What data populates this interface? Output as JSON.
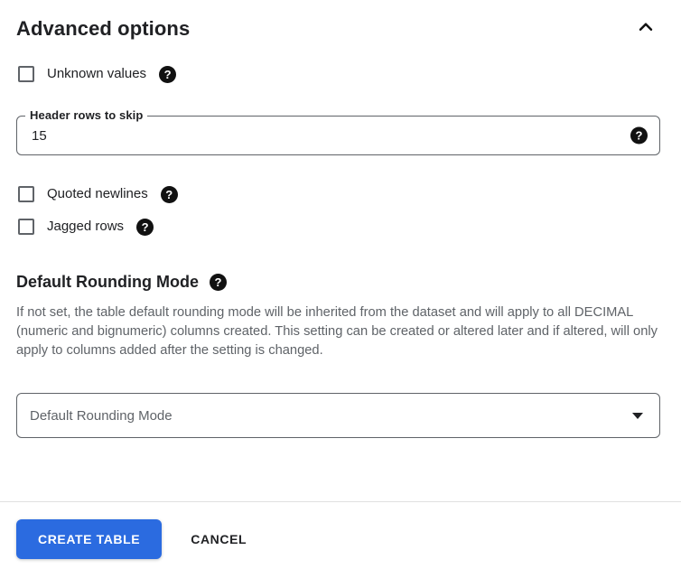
{
  "header": {
    "title": "Advanced options"
  },
  "fields": {
    "unknown_values": {
      "label": "Unknown values",
      "checked": false
    },
    "header_rows_to_skip": {
      "label": "Header rows to skip",
      "value": "15"
    },
    "quoted_newlines": {
      "label": "Quoted newlines",
      "checked": false
    },
    "jagged_rows": {
      "label": "Jagged rows",
      "checked": false
    },
    "default_rounding_mode": {
      "title": "Default Rounding Mode",
      "description": "If not set, the table default rounding mode will be inherited from the dataset and will apply to all DECIMAL (numeric and bignumeric) columns created. This setting can be created or altered later and if altered, will only apply to columns added after the setting is changed.",
      "placeholder": "Default Rounding Mode"
    }
  },
  "footer": {
    "create_button": "CREATE TABLE",
    "cancel_button": "CANCEL"
  },
  "icons": {
    "help_glyph": "?",
    "collapse": "chevron-up",
    "select_caret": "arrow-drop-down"
  },
  "colors": {
    "primary_button": "#2b6be0",
    "text_primary": "#202124",
    "text_secondary": "#5f6368",
    "checkbox_border": "#5f6368",
    "divider": "#e0e0e0",
    "help_icon_bg": "#111111"
  }
}
